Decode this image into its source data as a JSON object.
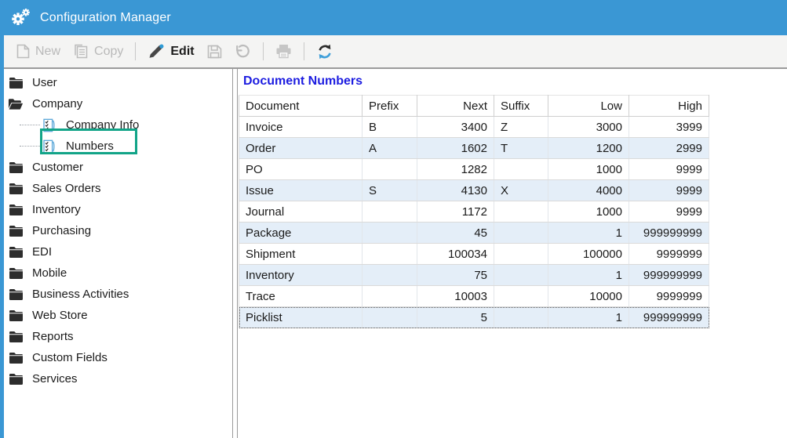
{
  "window": {
    "title": "Configuration Manager"
  },
  "colors": {
    "titlebar_blue": "#3A97D4",
    "heading_blue": "#1C1CE0",
    "annotation_green": "#12A488",
    "row_alt_blue": "#E4EEF8",
    "disabled_gray": "#B9B9B9",
    "refresh_blue": "#3F9FD9"
  },
  "toolbar": {
    "items": [
      {
        "type": "button",
        "name": "new-button",
        "label": "New",
        "icon": "new-document-icon",
        "enabled": false
      },
      {
        "type": "button",
        "name": "copy-button",
        "label": "Copy",
        "icon": "copy-icon",
        "enabled": false
      },
      {
        "type": "separator"
      },
      {
        "type": "button",
        "name": "edit-button",
        "label": "Edit",
        "icon": "edit-pencil-icon",
        "enabled": true
      },
      {
        "type": "button",
        "name": "save-button",
        "label": "",
        "icon": "save-icon",
        "enabled": false
      },
      {
        "type": "button",
        "name": "undo-button",
        "label": "",
        "icon": "undo-icon",
        "enabled": false
      },
      {
        "type": "separator"
      },
      {
        "type": "button",
        "name": "print-button",
        "label": "",
        "icon": "print-icon",
        "enabled": false
      },
      {
        "type": "separator"
      },
      {
        "type": "button",
        "name": "refresh-button",
        "label": "",
        "icon": "refresh-icon",
        "enabled": true
      }
    ]
  },
  "sidebar": {
    "items": [
      {
        "label": "User",
        "icon": "folder-icon",
        "level": 0
      },
      {
        "label": "Company",
        "icon": "folder-open-icon",
        "level": 0
      },
      {
        "label": "Company Info",
        "icon": "checklist-icon",
        "level": 1
      },
      {
        "label": "Numbers",
        "icon": "checklist-icon",
        "level": 1,
        "highlighted": true
      },
      {
        "label": "Customer",
        "icon": "folder-icon",
        "level": 0
      },
      {
        "label": "Sales Orders",
        "icon": "folder-icon",
        "level": 0
      },
      {
        "label": "Inventory",
        "icon": "folder-icon",
        "level": 0
      },
      {
        "label": "Purchasing",
        "icon": "folder-icon",
        "level": 0
      },
      {
        "label": "EDI",
        "icon": "folder-icon",
        "level": 0
      },
      {
        "label": "Mobile",
        "icon": "folder-icon",
        "level": 0
      },
      {
        "label": "Business Activities",
        "icon": "folder-icon",
        "level": 0
      },
      {
        "label": "Web Store",
        "icon": "folder-icon",
        "level": 0
      },
      {
        "label": "Reports",
        "icon": "folder-icon",
        "level": 0
      },
      {
        "label": "Custom Fields",
        "icon": "folder-icon",
        "level": 0
      },
      {
        "label": "Services",
        "icon": "folder-icon",
        "level": 0
      }
    ]
  },
  "main": {
    "heading": "Document Numbers",
    "table": {
      "columns": [
        {
          "label": "Document",
          "align": "left"
        },
        {
          "label": "Prefix",
          "align": "left"
        },
        {
          "label": "Next",
          "align": "right"
        },
        {
          "label": "Suffix",
          "align": "left"
        },
        {
          "label": "Low",
          "align": "right"
        },
        {
          "label": "High",
          "align": "right"
        }
      ],
      "rows": [
        [
          "Invoice",
          "B",
          "3400",
          "Z",
          "3000",
          "3999"
        ],
        [
          "Order",
          "A",
          "1602",
          "T",
          "1200",
          "2999"
        ],
        [
          "PO",
          "",
          "1282",
          "",
          "1000",
          "9999"
        ],
        [
          "Issue",
          "S",
          "4130",
          "X",
          "4000",
          "9999"
        ],
        [
          "Journal",
          "",
          "1172",
          "",
          "1000",
          "9999"
        ],
        [
          "Package",
          "",
          "45",
          "",
          "1",
          "999999999"
        ],
        [
          "Shipment",
          "",
          "100034",
          "",
          "100000",
          "9999999"
        ],
        [
          "Inventory",
          "",
          "75",
          "",
          "1",
          "999999999"
        ],
        [
          "Trace",
          "",
          "10003",
          "",
          "10000",
          "9999999"
        ],
        [
          "Picklist",
          "",
          "5",
          "",
          "1",
          "999999999"
        ]
      ],
      "selected_row": "Picklist"
    }
  }
}
